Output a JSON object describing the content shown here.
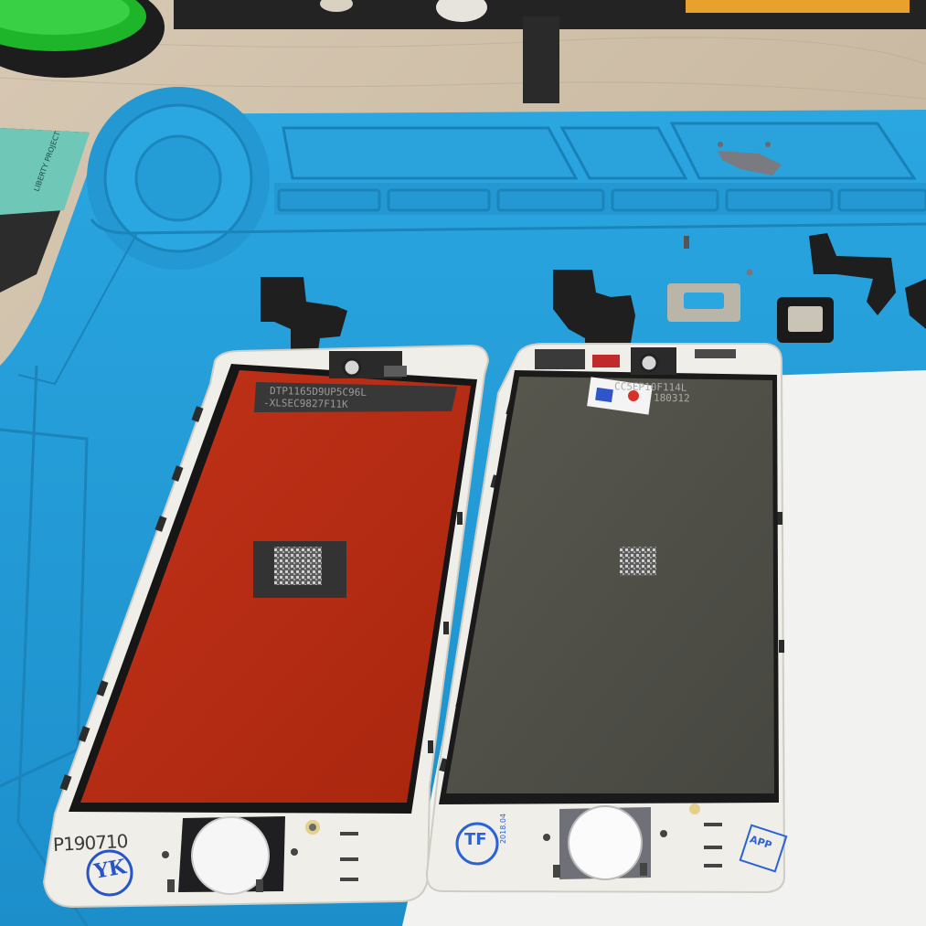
{
  "screen_left": {
    "label_top": "DTP1165D9UP5C96L",
    "label_bottom": "-XLSEC9827F11K",
    "stamp": "YK",
    "handwritten": "P190710"
  },
  "screen_right": {
    "label_top": "CC5EP10F114L",
    "label_bottom": "180312",
    "stamp_main": "TF",
    "stamp_date": "2018.04",
    "stamp_side": "APP"
  },
  "mat": {
    "color": "#2aa6e0"
  },
  "colors": {
    "red_film": "#b22a10",
    "grey_film": "#4f4f48",
    "frame": "#efeee8",
    "paper": "#f2f2f0"
  }
}
